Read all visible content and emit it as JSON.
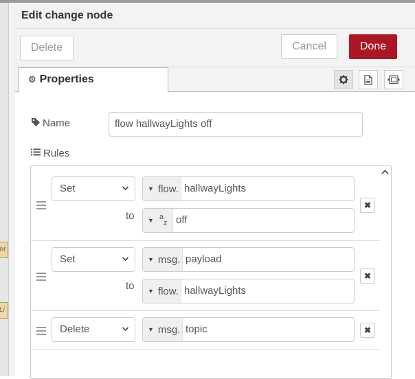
{
  "tray": {
    "title": "Edit change node",
    "delete_label": "Delete",
    "cancel_label": "Cancel",
    "done_label": "Done"
  },
  "canvas": {
    "node_stub_1": "ght",
    "node_stub_2": "yLi"
  },
  "tabs": {
    "properties_label": "Properties"
  },
  "form": {
    "name_label": "Name",
    "name_value": "flow hallwayLights off",
    "rules_label": "Rules",
    "to_label": "to"
  },
  "rules": [
    {
      "action": "Set",
      "target_type": "flow.",
      "target_value": "hallwayLights",
      "source_type_icon": "az-string-icon",
      "source_value": "off"
    },
    {
      "action": "Set",
      "target_type": "msg.",
      "target_value": "payload",
      "source_type": "flow.",
      "source_value": "hallwayLights"
    },
    {
      "action": "Delete",
      "target_type": "msg.",
      "target_value": "topic"
    }
  ],
  "colors": {
    "done_button": "#ad1625",
    "tray_header_bg": "#f3f3f3",
    "type_prefix_bg": "#efefef"
  }
}
